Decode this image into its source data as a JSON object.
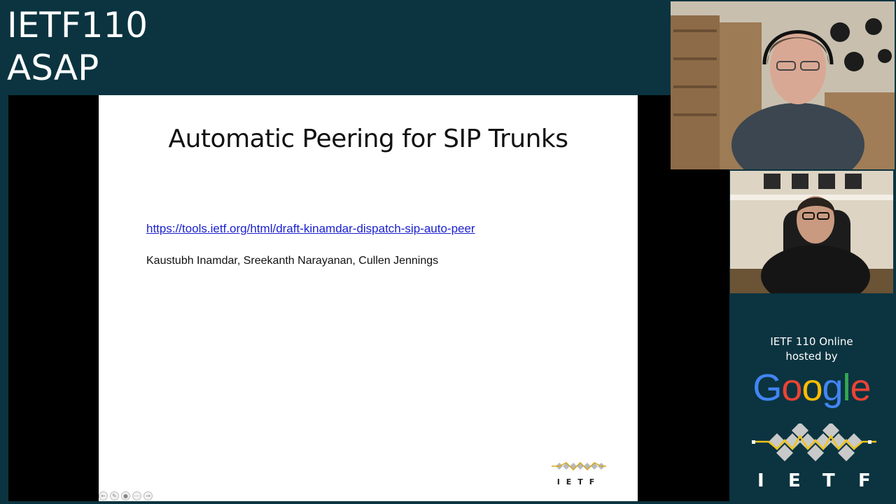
{
  "session": {
    "line1": "IETF110",
    "line2": "ASAP"
  },
  "slide": {
    "title": "Automatic Peering for SIP Trunks",
    "link": "https://tools.ietf.org/html/draft-kinamdar-dispatch-sip-auto-peer",
    "authors": "Kaustubh Inamdar, Sreekanth Narayanan, Cullen Jennings",
    "logo_text": "IETF"
  },
  "sponsor": {
    "line1": "IETF 110 Online",
    "line2": "hosted by",
    "google_letters": [
      "G",
      "o",
      "o",
      "g",
      "l",
      "e"
    ],
    "google_colors": [
      "#4285F4",
      "#EA4335",
      "#FBBC05",
      "#4285F4",
      "#34A853",
      "#EA4335"
    ],
    "ietf_letters": [
      "I",
      "E",
      "T",
      "F"
    ]
  },
  "colors": {
    "background": "#0b3440",
    "link": "#1a1fcf",
    "ietf_gold": "#f0c419",
    "ietf_gray": "#c9c9c9"
  }
}
